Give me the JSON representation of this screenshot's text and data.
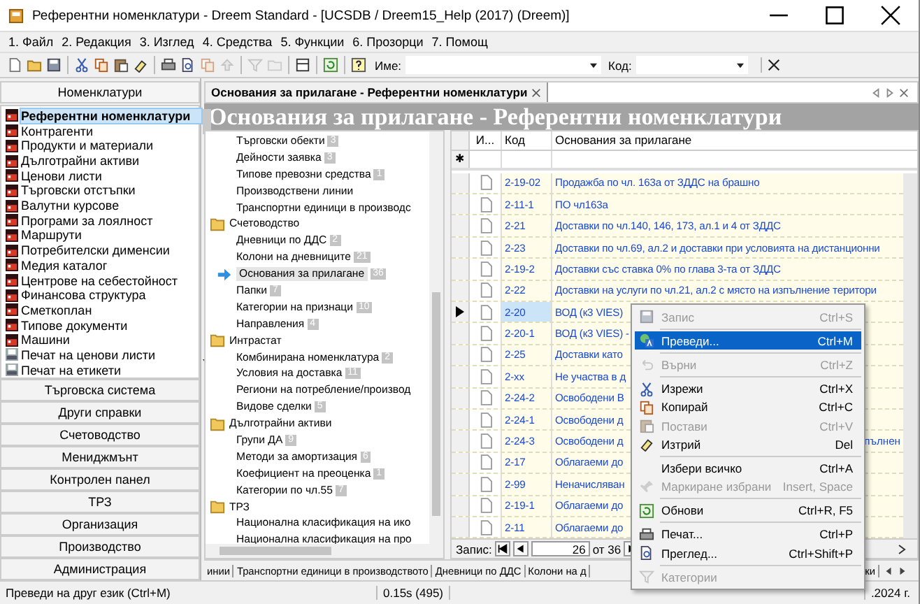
{
  "window": {
    "title": "Референтни номенклатури - Dreem Standard - [UCSDB / Dreem15_Help (2017) (Dreem)]"
  },
  "menu": [
    "1. Файл",
    "2. Редакция",
    "3. Изглед",
    "4. Средства",
    "5. Функции",
    "6. Прозорци",
    "7. Помощ"
  ],
  "toolbar": {
    "name_label": "Име:",
    "code_label": "Код:"
  },
  "sidebar": {
    "header": "Номенклатури",
    "items": [
      {
        "label": "Референтни номенклатури",
        "kind": "nomenclature",
        "selected": true
      },
      {
        "label": "Контрагенти",
        "kind": "nomenclature",
        "selected": false
      },
      {
        "label": "Продукти и материали",
        "kind": "nomenclature",
        "selected": false
      },
      {
        "label": "Дълготрайни активи",
        "kind": "nomenclature",
        "selected": false
      },
      {
        "label": "Ценови листи",
        "kind": "nomenclature",
        "selected": false
      },
      {
        "label": "Търговски отстъпки",
        "kind": "nomenclature",
        "selected": false
      },
      {
        "label": "Валутни курсове",
        "kind": "nomenclature",
        "selected": false
      },
      {
        "label": "Програми за лоялност",
        "kind": "nomenclature",
        "selected": false
      },
      {
        "label": "Маршрути",
        "kind": "nomenclature",
        "selected": false
      },
      {
        "label": "Потребителски дименсии",
        "kind": "nomenclature",
        "selected": false
      },
      {
        "label": "Медия каталог",
        "kind": "nomenclature",
        "selected": false
      },
      {
        "label": "Центрове на себестойност",
        "kind": "nomenclature",
        "selected": false
      },
      {
        "label": "Финансова структура",
        "kind": "nomenclature",
        "selected": false
      },
      {
        "label": "Сметкоплан",
        "kind": "nomenclature",
        "selected": false
      },
      {
        "label": "Типове документи",
        "kind": "nomenclature",
        "selected": false
      },
      {
        "label": "Машини",
        "kind": "nomenclature",
        "selected": false
      },
      {
        "label": "Печат на ценови листи",
        "kind": "print",
        "selected": false
      },
      {
        "label": "Печат на етикети",
        "kind": "print",
        "selected": false
      }
    ],
    "sections": [
      "Търговска система",
      "Други справки",
      "Счетоводство",
      "Мениджмънт",
      "Контролен панел",
      "ТРЗ",
      "Организация",
      "Производство",
      "Администрация"
    ]
  },
  "document_tab": {
    "label": "Основания за прилагане - Референтни номенклатури"
  },
  "page_title": "Основания за прилагане - Референтни номенклатури",
  "tree": [
    {
      "children": [
        {
          "label": "Търговски обекти",
          "count": "3",
          "selected": false
        },
        {
          "label": "Дейности заявка",
          "count": "3",
          "selected": false
        },
        {
          "label": "Типове превозни средства",
          "count": "1",
          "selected": false
        },
        {
          "label": "Производствени линии",
          "selected": false
        },
        {
          "label": "Транспортни единици в производс",
          "selected": false
        }
      ]
    },
    {
      "label": "Счетоводство",
      "selected": false,
      "children": [
        {
          "label": "Дневници по ДДС",
          "count": "2",
          "selected": false
        },
        {
          "label": "Колони на дневниците",
          "count": "21",
          "selected": false
        },
        {
          "label": "Основания за прилагане",
          "count": "36",
          "selected": true
        },
        {
          "label": "Папки",
          "count": "7",
          "selected": false
        },
        {
          "label": "Категории на признаци",
          "count": "10",
          "selected": false
        },
        {
          "label": "Направления",
          "count": "4",
          "selected": false
        }
      ]
    },
    {
      "label": "Интрастат",
      "selected": false,
      "children": [
        {
          "label": "Комбинирана номенклатура",
          "count": "2",
          "selected": false
        },
        {
          "label": "Условия на доставка",
          "count": "11",
          "selected": false
        },
        {
          "label": "Региони на потребление/производ",
          "selected": false
        },
        {
          "label": "Видове сделки",
          "count": "5",
          "selected": false
        }
      ]
    },
    {
      "label": "Дълготрайни активи",
      "selected": false,
      "children": [
        {
          "label": "Групи ДА",
          "count": "9",
          "selected": false
        },
        {
          "label": "Методи за амортизация",
          "count": "6",
          "selected": false
        },
        {
          "label": "Коефициент на преоценка",
          "count": "1",
          "selected": false
        },
        {
          "label": "Категории по чл.55",
          "count": "7",
          "selected": false
        }
      ]
    },
    {
      "label": "ТРЗ",
      "selected": false,
      "children": [
        {
          "label": "Национална класификация на ико",
          "selected": false
        },
        {
          "label": "Национална класификация на про",
          "selected": false
        }
      ]
    }
  ],
  "table": {
    "columns": [
      "И...",
      "Код",
      "Основания за прилагане"
    ],
    "new_row_marker": "✱",
    "rows": [
      {
        "code": "2-19-02",
        "text": "Продажба по чл. 163а от ЗДДС на брашно",
        "selected": false
      },
      {
        "code": "2-11-1",
        "text": "ПО чл163а",
        "selected": false
      },
      {
        "code": "2-21",
        "text": "Доставки по чл.140, 146, 173, ал.1 и 4 от ЗДДС",
        "selected": false
      },
      {
        "code": "2-23",
        "text": "Доставки по чл.69, ал.2 и доставки при условията на дистанционни",
        "selected": false
      },
      {
        "code": "2-19-2",
        "text": "Доставки със ставка 0% по глава 3-та от ЗДДС",
        "selected": false
      },
      {
        "code": "2-22",
        "text": "Доставки на услуги по чл.21, ал.2 с място на изпълнение територи",
        "selected": false
      },
      {
        "code": "2-20",
        "text": "ВОД (к3 VIES)",
        "selected": true
      },
      {
        "code": "2-20-1",
        "text": "ВОД (к3 VIES) -",
        "selected": false
      },
      {
        "code": "2-25",
        "text": "Доставки като",
        "selected": false
      },
      {
        "code": "2-xx",
        "text": "Не участва в д",
        "selected": false
      },
      {
        "code": "2-24-2",
        "text": "Освободени В",
        "selected": false
      },
      {
        "code": "2-24-1",
        "text": "Освободени д",
        "selected": false
      },
      {
        "code": "2-24-3",
        "text": "Освободени д",
        "tail": "пълнен",
        "selected": false
      },
      {
        "code": "2-17",
        "text": "Облагаеми до",
        "selected": false
      },
      {
        "code": "2-99",
        "text": "Неначисляван",
        "selected": false
      },
      {
        "code": "2-19-1",
        "text": "Облагаеми до",
        "selected": false
      },
      {
        "code": "2-11",
        "text": "Облагаеми до",
        "selected": false
      }
    ]
  },
  "pager": {
    "label": "Запис:",
    "value": "26",
    "total": "от 36"
  },
  "bottom_tabs": {
    "left": [
      "инии",
      "Транспортни единици в производството",
      "Дневници по ДДС",
      "Колони на д"
    ],
    "right": "ки"
  },
  "context_menu": [
    {
      "kind": "item",
      "label": "Запис",
      "shortcut": "Ctrl+S",
      "disabled": true,
      "selected": false
    },
    {
      "kind": "separator"
    },
    {
      "kind": "item",
      "label": "Преведи...",
      "shortcut": "Ctrl+M",
      "disabled": false,
      "selected": true
    },
    {
      "kind": "separator"
    },
    {
      "kind": "item",
      "label": "Върни",
      "shortcut": "Ctrl+Z",
      "disabled": true,
      "selected": false
    },
    {
      "kind": "separator"
    },
    {
      "kind": "item",
      "label": "Изрежи",
      "shortcut": "Ctrl+X",
      "disabled": false,
      "selected": false
    },
    {
      "kind": "item",
      "label": "Копирай",
      "shortcut": "Ctrl+C",
      "disabled": false,
      "selected": false
    },
    {
      "kind": "item",
      "label": "Постави",
      "shortcut": "Ctrl+V",
      "disabled": true,
      "selected": false
    },
    {
      "kind": "item",
      "label": "Изтрий",
      "shortcut": "Del",
      "disabled": false,
      "selected": false
    },
    {
      "kind": "separator"
    },
    {
      "kind": "item",
      "label": "Избери всичко",
      "shortcut": "Ctrl+A",
      "disabled": false,
      "selected": false
    },
    {
      "kind": "item",
      "label": "Маркиране избрани",
      "shortcut": "Insert, Space",
      "disabled": true,
      "selected": false
    },
    {
      "kind": "separator"
    },
    {
      "kind": "item",
      "label": "Обнови",
      "shortcut": "Ctrl+R, F5",
      "disabled": false,
      "selected": false
    },
    {
      "kind": "separator"
    },
    {
      "kind": "item",
      "label": "Печат...",
      "shortcut": "Ctrl+P",
      "disabled": false,
      "selected": false
    },
    {
      "kind": "item",
      "label": "Преглед...",
      "shortcut": "Ctrl+Shift+P",
      "disabled": false,
      "selected": false
    },
    {
      "kind": "separator"
    },
    {
      "kind": "item",
      "label": "Категории",
      "disabled": true,
      "selected": false
    }
  ],
  "status_bar": {
    "message": "Преведи на друг език (Ctrl+M)",
    "timing": "0.15s (495)",
    "date": ".2024 г."
  }
}
